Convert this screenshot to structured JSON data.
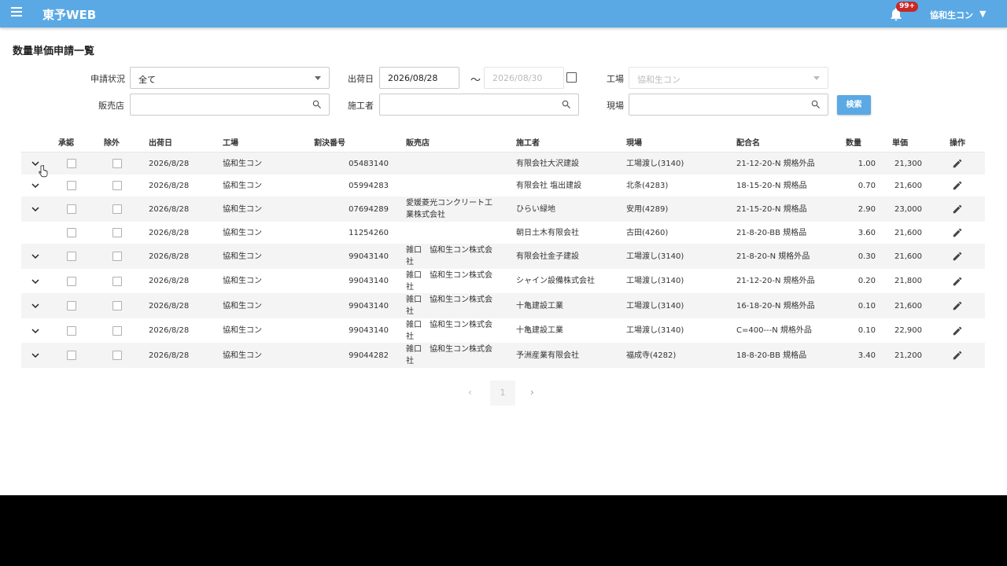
{
  "app": {
    "title": "東予WEB",
    "notification_badge": "99+",
    "user_name": "協和生コン",
    "user_caret": "▼"
  },
  "page": {
    "title": "数量単価申請一覧"
  },
  "filters": {
    "status_label": "申請状況",
    "status_value": "全て",
    "ship_date_label": "出荷日",
    "ship_date_from": "2026/08/28",
    "ship_date_sep": "〜",
    "ship_date_to": "2026/08/30",
    "factory_label": "工場",
    "factory_value": "協和生コン",
    "dealer_label": "販売店",
    "dealer_value": "",
    "contractor_label": "施工者",
    "contractor_value": "",
    "site_label": "現場",
    "site_value": "",
    "search_button": "検索"
  },
  "table": {
    "headers": {
      "approve": "承認",
      "exclude": "除外",
      "ship_date": "出荷日",
      "factory": "工場",
      "ruling_no": "割決番号",
      "dealer": "販売店",
      "contractor": "施工者",
      "site": "現場",
      "mix": "配合名",
      "qty": "数量",
      "price": "単価",
      "ops": "操作"
    },
    "rows": [
      {
        "expand": true,
        "date": "2026/8/28",
        "factory": "協和生コン",
        "no": "05483140",
        "dealer": "",
        "contractor": "有限会社大沢建設",
        "site": "工場渡し(3140)",
        "mix": "21-12-20-N 規格外品",
        "qty": "1.00",
        "price": "21,300"
      },
      {
        "expand": true,
        "date": "2026/8/28",
        "factory": "協和生コン",
        "no": "05994283",
        "dealer": "",
        "contractor": "有限会社 塩出建設",
        "site": "北条(4283)",
        "mix": "18-15-20-N 規格品",
        "qty": "0.70",
        "price": "21,600"
      },
      {
        "expand": true,
        "date": "2026/8/28",
        "factory": "協和生コン",
        "no": "07694289",
        "dealer": "愛媛菱光コンクリート工業株式会社",
        "contractor": "ひらい緑地",
        "site": "安用(4289)",
        "mix": "21-15-20-N 規格品",
        "qty": "2.90",
        "price": "23,000"
      },
      {
        "expand": false,
        "date": "2026/8/28",
        "factory": "協和生コン",
        "no": "11254260",
        "dealer": "",
        "contractor": "朝日土木有限会社",
        "site": "古田(4260)",
        "mix": "21-8-20-BB 規格品",
        "qty": "3.60",
        "price": "21,600"
      },
      {
        "expand": true,
        "date": "2026/8/28",
        "factory": "協和生コン",
        "no": "99043140",
        "dealer": "雑口　協和生コン株式会社",
        "contractor": "有限会社金子建設",
        "site": "工場渡し(3140)",
        "mix": "21-8-20-N 規格外品",
        "qty": "0.30",
        "price": "21,600"
      },
      {
        "expand": true,
        "date": "2026/8/28",
        "factory": "協和生コン",
        "no": "99043140",
        "dealer": "雑口　協和生コン株式会社",
        "contractor": "シャイン設備株式会社",
        "site": "工場渡し(3140)",
        "mix": "21-12-20-N 規格外品",
        "qty": "0.20",
        "price": "21,800"
      },
      {
        "expand": true,
        "date": "2026/8/28",
        "factory": "協和生コン",
        "no": "99043140",
        "dealer": "雑口　協和生コン株式会社",
        "contractor": "十亀建設工業",
        "site": "工場渡し(3140)",
        "mix": "16-18-20-N 規格外品",
        "qty": "0.10",
        "price": "21,600"
      },
      {
        "expand": true,
        "date": "2026/8/28",
        "factory": "協和生コン",
        "no": "99043140",
        "dealer": "雑口　協和生コン株式会社",
        "contractor": "十亀建設工業",
        "site": "工場渡し(3140)",
        "mix": "C=400---N 規格外品",
        "qty": "0.10",
        "price": "22,900"
      },
      {
        "expand": true,
        "date": "2026/8/28",
        "factory": "協和生コン",
        "no": "99044282",
        "dealer": "雑口　協和生コン株式会社",
        "contractor": "予洲産業有限会社",
        "site": "福成寺(4282)",
        "mix": "18-8-20-BB 規格品",
        "qty": "3.40",
        "price": "21,200"
      }
    ]
  },
  "pagination": {
    "prev": "‹",
    "current": "1",
    "next": "›"
  },
  "colors": {
    "primary": "#5ba9e4",
    "badge": "#c62828",
    "row_shade": "#f4f4f4"
  }
}
